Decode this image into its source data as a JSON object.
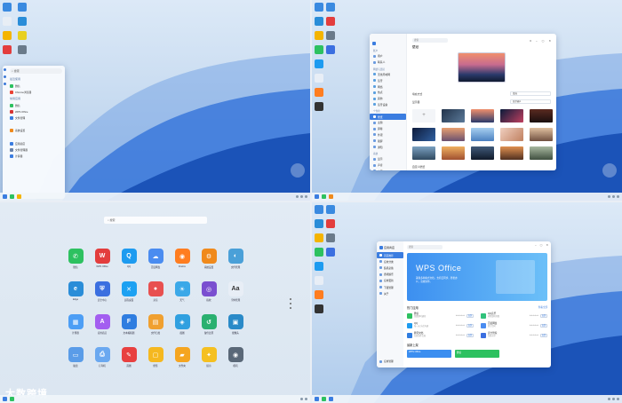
{
  "quadrants": {
    "q1": {
      "name": "desktop with start menu"
    },
    "q2": {
      "name": "settings window"
    },
    "q3": {
      "name": "launcher"
    },
    "q4": {
      "name": "app store"
    }
  },
  "start_menu": {
    "search": "搜索",
    "sections": [
      {
        "title": "最近使用",
        "items": [
          {
            "label": "微信",
            "color": "#2dc160"
          },
          {
            "label": "Chrome浏览器",
            "color": "#ea4335"
          }
        ]
      },
      {
        "title": "常用应用",
        "items": [
          {
            "label": "微信",
            "color": "#2dc160"
          },
          {
            "label": "WPS Office",
            "color": "#d63333"
          },
          {
            "label": "文件管理",
            "color": "#3b7de0"
          }
        ]
      },
      {
        "title": "",
        "items": [
          {
            "label": "系统设置",
            "color": "#f08a1c"
          }
        ]
      },
      {
        "title": "",
        "items": [
          {
            "label": "应用商店",
            "color": "#3b7de0"
          },
          {
            "label": "文件管理器",
            "color": "#6a82a8"
          },
          {
            "label": "计算器",
            "color": "#3b7de0"
          }
        ]
      }
    ]
  },
  "settings": {
    "search": "搜索",
    "title": "壁纸",
    "nav": [
      {
        "group": "账户",
        "items": [
          "用户",
          "联系人"
        ]
      },
      {
        "group": "网络与连接",
        "items": [
          "无线局域网",
          "蓝牙",
          "网络",
          "热点",
          "其他",
          "蓝牙设备"
        ]
      },
      {
        "group": "个性化",
        "items": [
          "壁纸",
          "主题",
          "屏幕",
          "外观",
          "锁屏",
          "通知"
        ]
      },
      {
        "group": "系统",
        "items": [
          "显示",
          "声音",
          "电源",
          "关于"
        ]
      }
    ],
    "active": "壁纸",
    "fit_label": "填充方式",
    "fit_value": "填充",
    "color_label": "显示器",
    "color_value": "显示器1",
    "bottom_label": "自定义壁纸"
  },
  "launcher": {
    "search": "搜索",
    "apps": [
      {
        "label": "微信",
        "color": "#2dc160",
        "glyph": "✆"
      },
      {
        "label": "WPS Office",
        "color": "#e33d3d",
        "glyph": "W"
      },
      {
        "label": "QQ",
        "color": "#1d9bf0",
        "glyph": "Q"
      },
      {
        "label": "百度网盘",
        "color": "#4a8cf0",
        "glyph": "☁"
      },
      {
        "label": "Firefox",
        "color": "#ff7d20",
        "glyph": "◉"
      },
      {
        "label": "系统设置",
        "color": "#f08a1c",
        "glyph": "⚙"
      },
      {
        "label": "文件管理",
        "color": "#4aa0d8",
        "glyph": "◐"
      },
      {
        "label": "",
        "color": "#000000",
        "glyph": ""
      },
      {
        "label": "Edge",
        "color": "#2a8dd8",
        "glyph": "e"
      },
      {
        "label": "安全中心",
        "color": "#3b6fe0",
        "glyph": "⛨"
      },
      {
        "label": "远程桌面",
        "color": "#1da1f2",
        "glyph": "✕"
      },
      {
        "label": "录音",
        "color": "#e85050",
        "glyph": "●"
      },
      {
        "label": "天气",
        "color": "#3ba8e8",
        "glyph": "☀"
      },
      {
        "label": "指纹",
        "color": "#7a4fd0",
        "glyph": "◎"
      },
      {
        "label": "字体管理",
        "color": "#e8eef6",
        "glyph": "Aa"
      },
      {
        "label": "",
        "color": "#000000",
        "glyph": ""
      },
      {
        "label": "计算器",
        "color": "#4d9ef5",
        "glyph": "▦"
      },
      {
        "label": "应用商店",
        "color": "#a35ef0",
        "glyph": "A"
      },
      {
        "label": "文本编辑器",
        "color": "#2f7de0",
        "glyph": "F"
      },
      {
        "label": "文件归档",
        "color": "#f0a030",
        "glyph": "▤"
      },
      {
        "label": "截图",
        "color": "#30a0e0",
        "glyph": "◈"
      },
      {
        "label": "备份还原",
        "color": "#2ab070",
        "glyph": "↺"
      },
      {
        "label": "摄像头",
        "color": "#2a8ac8",
        "glyph": "▣"
      },
      {
        "label": "",
        "color": "#000000",
        "glyph": ""
      },
      {
        "label": "磁盘",
        "color": "#5a9ce8",
        "glyph": "▭"
      },
      {
        "label": "打印机",
        "color": "#6aa8f0",
        "glyph": "⎙"
      },
      {
        "label": "画图",
        "color": "#e84040",
        "glyph": "✎"
      },
      {
        "label": "便签",
        "color": "#f5b820",
        "glyph": "▢"
      },
      {
        "label": "文件夹",
        "color": "#f5a520",
        "glyph": "▰"
      },
      {
        "label": "提示",
        "color": "#f5c020",
        "glyph": "✦"
      },
      {
        "label": "相机",
        "color": "#5a6878",
        "glyph": "◉"
      },
      {
        "label": "",
        "color": "#000000",
        "glyph": ""
      }
    ],
    "watermark": "大数跨境"
  },
  "store": {
    "title": "应用商店",
    "search": "搜索",
    "nav": [
      "首页推荐",
      "应用分类",
      "装机必备",
      "游戏娱乐",
      "应用更新",
      "下载管理",
      "关于"
    ],
    "active": "首页推荐",
    "banner_title": "WPS Office",
    "banner_sub": "兼容多种格式文档，支持云同步，轻松办公，高效协作。",
    "hot_title": "热门应用",
    "hot_more": "查看全部",
    "hot_apps": [
      {
        "name": "微信",
        "desc": "免费即时通讯",
        "color": "#2dc160",
        "btn": "安装"
      },
      {
        "name": "QQ音乐",
        "desc": "听我想听的歌",
        "color": "#31c27c",
        "btn": "安装"
      },
      {
        "name": "QQ",
        "desc": "每一天 乐在沟通",
        "color": "#1d9bf0",
        "btn": "安装"
      },
      {
        "name": "百度网盘",
        "desc": "超大空间",
        "color": "#4a8cf0",
        "btn": "安装"
      },
      {
        "name": "腾讯文档",
        "desc": "在线协作文档",
        "color": "#2f7de0",
        "btn": "安装"
      },
      {
        "name": "安全管家",
        "desc": "系统守护",
        "color": "#3b6fe0",
        "btn": "安装"
      }
    ],
    "latest_title": "最新上架",
    "latest": [
      {
        "label": "WPS Office",
        "color": "#3b8ef0"
      },
      {
        "label": "微信",
        "color": "#2dc160"
      }
    ],
    "sidebar_bottom": "应用管理"
  }
}
